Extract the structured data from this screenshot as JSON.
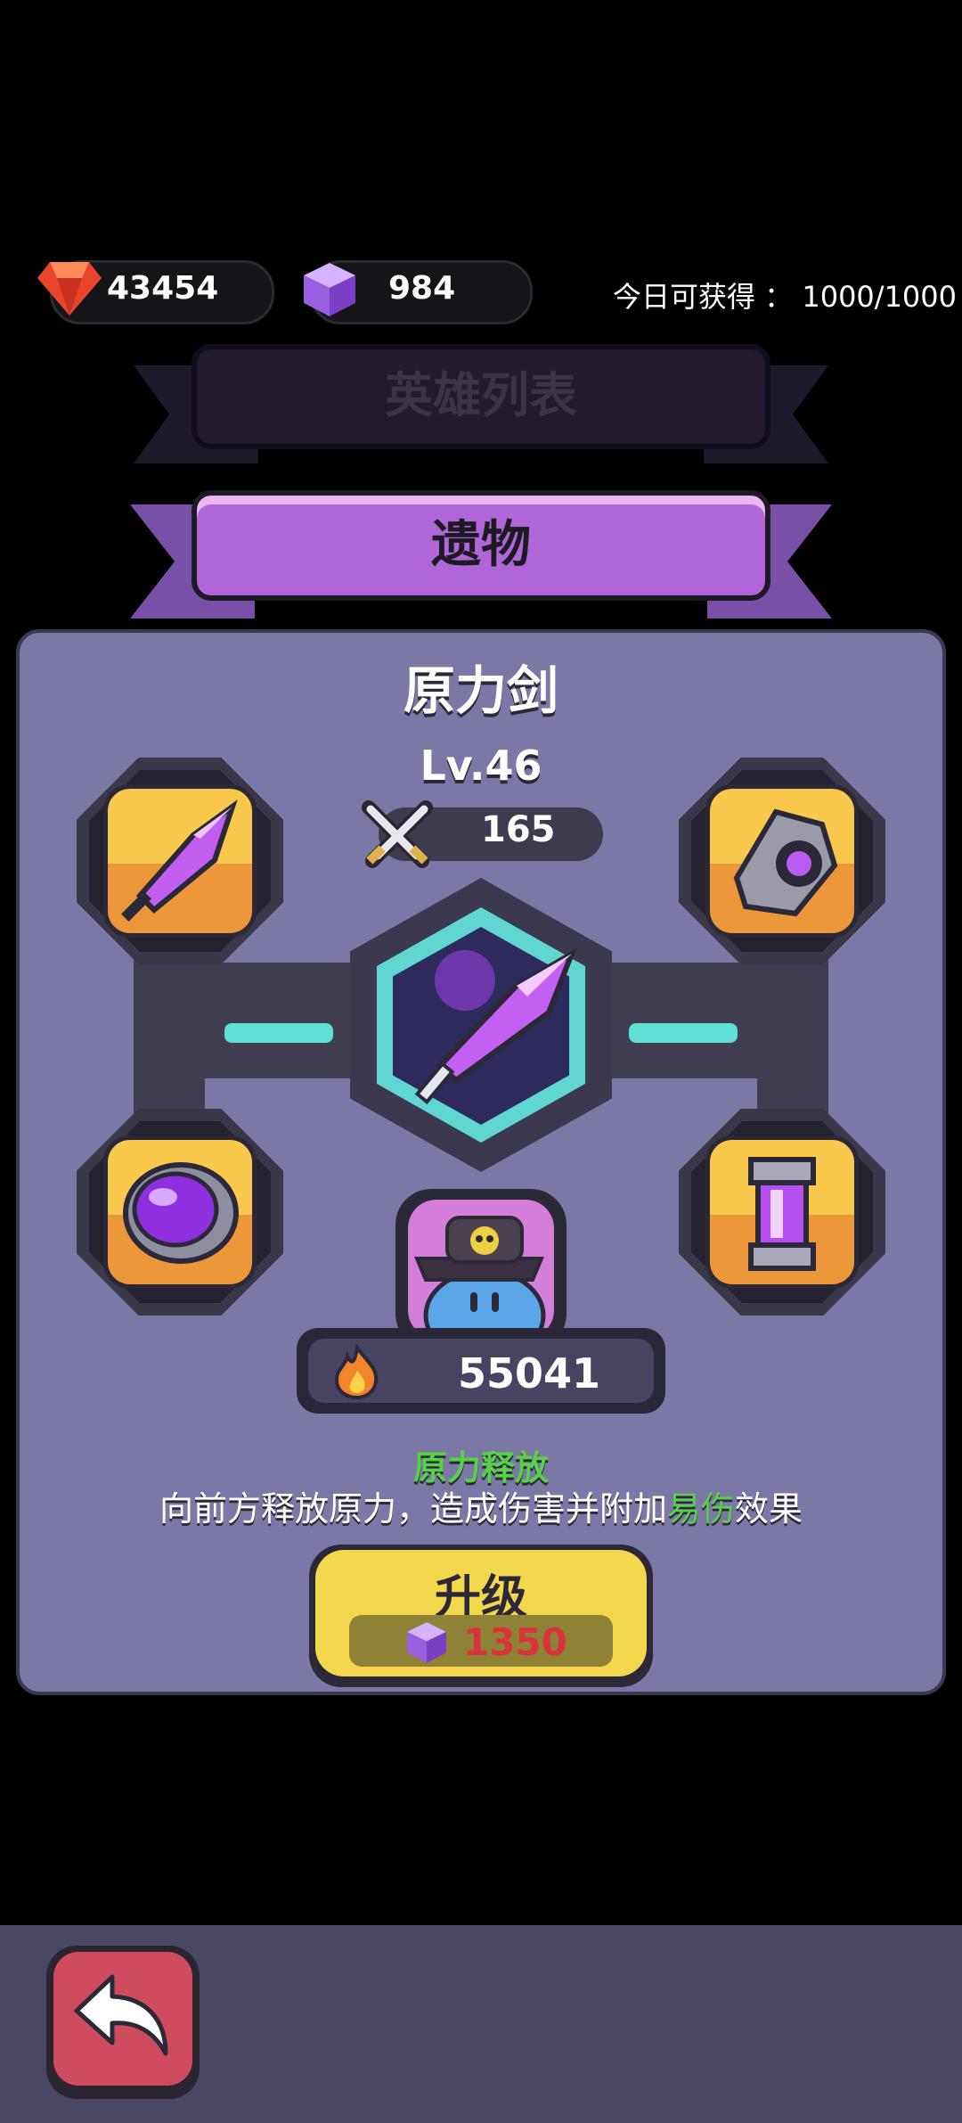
{
  "currency": {
    "gems": "43454",
    "cubes": "984",
    "today_label": "今日可获得 ：",
    "today_value": "1000/1000"
  },
  "tabs": {
    "hero_list": "英雄列表",
    "relics": "遗物"
  },
  "relic": {
    "name": "原力剑",
    "level": "Lv.46",
    "attack": "165",
    "power": "55041",
    "skill_name": "原力释放",
    "skill_desc_prefix": "向前方释放原力，造成伤害并附加",
    "skill_highlight": "易伤",
    "skill_desc_suffix": "效果"
  },
  "upgrade": {
    "label": "升级",
    "cost": "1350"
  },
  "colors": {
    "accent_purple": "#b066d8",
    "panel": "#7b78a6",
    "highlight_green": "#58d04a",
    "cost_red": "#d8333b"
  },
  "icons": [
    "ruby-gem-icon",
    "purple-cube-icon",
    "crossed-swords-icon",
    "flame-icon",
    "back-arrow-icon"
  ]
}
